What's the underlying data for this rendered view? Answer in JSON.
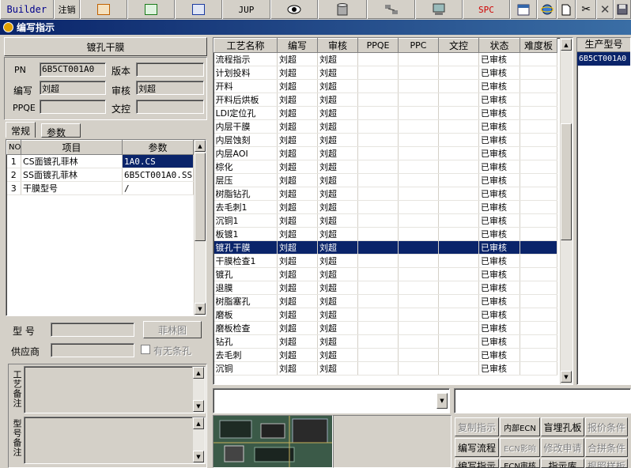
{
  "toolbar": {
    "builder": "Builder",
    "logout": "注销",
    "jup": "JUP",
    "spc": "SPC"
  },
  "window": {
    "title": "编写指示"
  },
  "plating": {
    "header": "镀孔干膜",
    "pn_label": "PN",
    "pn_value": "6B5CT001A0",
    "version_label": "版本",
    "version_value": "",
    "writer_label": "编写",
    "writer_value": "刘超",
    "reviewer_label": "审核",
    "reviewer_value": "刘超",
    "ppqe_label": "PPQE",
    "ppqe_value": "",
    "doc_control_label": "文控",
    "doc_control_value": ""
  },
  "tabs": [
    "常规",
    "参数"
  ],
  "param_table": {
    "columns": [
      "NO",
      "项目",
      "参数"
    ],
    "rows": [
      [
        "1",
        "CS面镀孔菲林",
        "1A0.CS"
      ],
      [
        "2",
        "SS面镀孔菲林",
        "6B5CT001A0.SS"
      ],
      [
        "3",
        "干膜型号",
        "/"
      ]
    ]
  },
  "model": {
    "model_label": "型 号",
    "model_value": "",
    "film_button": "菲林图",
    "supplier_label": "供应商",
    "supplier_value": "",
    "strip_hole_label": "有无条孔"
  },
  "notes": {
    "process_label": "工艺备注",
    "model_label": "型号备注"
  },
  "process_table": {
    "columns": [
      "工艺名称",
      "编写",
      "审核",
      "PPQE",
      "PPC",
      "文控",
      "状态",
      "难度板"
    ],
    "rows": [
      [
        "流程指示",
        "刘超",
        "刘超",
        "",
        "",
        "",
        "已审核",
        ""
      ],
      [
        "计划投料",
        "刘超",
        "刘超",
        "",
        "",
        "",
        "已审核",
        ""
      ],
      [
        "开料",
        "刘超",
        "刘超",
        "",
        "",
        "",
        "已审核",
        ""
      ],
      [
        "开料后烘板",
        "刘超",
        "刘超",
        "",
        "",
        "",
        "已审核",
        ""
      ],
      [
        "LDI定位孔",
        "刘超",
        "刘超",
        "",
        "",
        "",
        "已审核",
        ""
      ],
      [
        "内层干膜",
        "刘超",
        "刘超",
        "",
        "",
        "",
        "已审核",
        ""
      ],
      [
        "内层蚀刻",
        "刘超",
        "刘超",
        "",
        "",
        "",
        "已审核",
        ""
      ],
      [
        "内层AOI",
        "刘超",
        "刘超",
        "",
        "",
        "",
        "已审核",
        ""
      ],
      [
        "棕化",
        "刘超",
        "刘超",
        "",
        "",
        "",
        "已审核",
        ""
      ],
      [
        "层压",
        "刘超",
        "刘超",
        "",
        "",
        "",
        "已审核",
        ""
      ],
      [
        "树脂钻孔",
        "刘超",
        "刘超",
        "",
        "",
        "",
        "已审核",
        ""
      ],
      [
        "去毛刺1",
        "刘超",
        "刘超",
        "",
        "",
        "",
        "已审核",
        ""
      ],
      [
        "沉铜1",
        "刘超",
        "刘超",
        "",
        "",
        "",
        "已审核",
        ""
      ],
      [
        "板镀1",
        "刘超",
        "刘超",
        "",
        "",
        "",
        "已审核",
        ""
      ],
      [
        "镀孔干膜",
        "刘超",
        "刘超",
        "",
        "",
        "",
        "已审核",
        ""
      ],
      [
        "干膜检查1",
        "刘超",
        "刘超",
        "",
        "",
        "",
        "已审核",
        ""
      ],
      [
        "镀孔",
        "刘超",
        "刘超",
        "",
        "",
        "",
        "已审核",
        ""
      ],
      [
        "退膜",
        "刘超",
        "刘超",
        "",
        "",
        "",
        "已审核",
        ""
      ],
      [
        "树脂塞孔",
        "刘超",
        "刘超",
        "",
        "",
        "",
        "已审核",
        ""
      ],
      [
        "磨板",
        "刘超",
        "刘超",
        "",
        "",
        "",
        "已审核",
        ""
      ],
      [
        "磨板检查",
        "刘超",
        "刘超",
        "",
        "",
        "",
        "已审核",
        ""
      ],
      [
        "钻孔",
        "刘超",
        "刘超",
        "",
        "",
        "",
        "已审核",
        ""
      ],
      [
        "去毛刺",
        "刘超",
        "刘超",
        "",
        "",
        "",
        "已审核",
        ""
      ],
      [
        "沉铜",
        "刘超",
        "刘超",
        "",
        "",
        "",
        "已审核",
        ""
      ]
    ],
    "selected_index": 14
  },
  "production_models": {
    "header": "生产型号",
    "items": [
      "6B5CT001A0"
    ]
  },
  "actions": {
    "row1": [
      "复制指示",
      "内部ECN",
      "盲埋孔板",
      "报价条件"
    ],
    "row2": [
      "编写流程",
      "ECN影响",
      "修改申请",
      "合拼条件"
    ],
    "row3": [
      "编写指示",
      "ECN审核",
      "指示库",
      "根照样板"
    ]
  },
  "colors": {
    "selection": "#0a246a",
    "face": "#d4d0c8",
    "title_start": "#0a246a",
    "title_end": "#3a6ea5"
  }
}
